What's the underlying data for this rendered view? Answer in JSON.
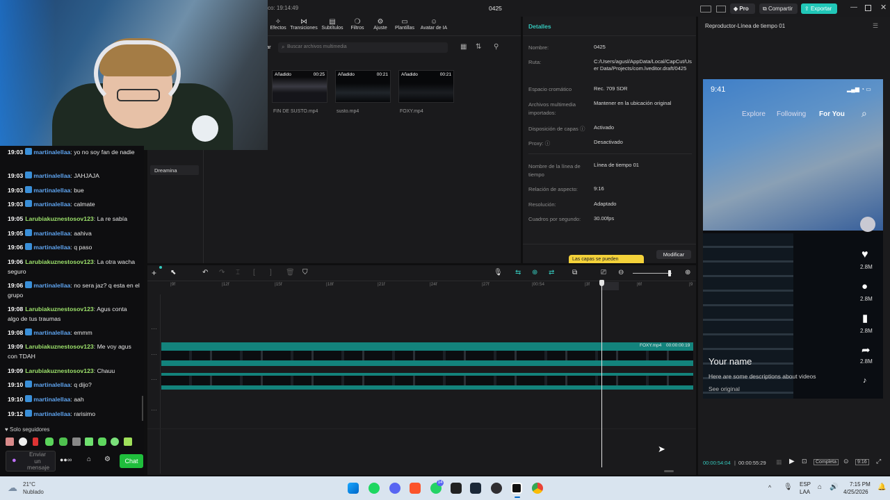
{
  "titlebar": {
    "time_text": "co: 19:14:49",
    "project_name": "0425",
    "pro_label": "Pro",
    "share_label": "Compartir",
    "export_label": "Exportar"
  },
  "toolbar": {
    "tabs": [
      "Efectos",
      "Transiciones",
      "Subtítulos",
      "Filtros",
      "Ajuste",
      "Plantillas",
      "Avatar de IA"
    ]
  },
  "media": {
    "search_placeholder": "Buscar archivos multimedia",
    "side_button": "ar",
    "sidebar_item": "Dreamina",
    "clips": [
      {
        "tag": "Añadido",
        "duration": "00:25",
        "name": "FIN DE SUSTO.mp4"
      },
      {
        "tag": "Añadido",
        "duration": "00:21",
        "name": "susto.mp4"
      },
      {
        "tag": "Añadido",
        "duration": "00:21",
        "name": "FOXY.mp4"
      }
    ]
  },
  "details": {
    "title": "Detalles",
    "rows": [
      {
        "label": "Nombre:",
        "value": "0425"
      },
      {
        "label": "Ruta:",
        "value": "C:/Users/agusl/AppData/Local/CapCut/User Data/Projects/com.lveditor.draft/0425"
      },
      {
        "label": "Espacio cromático",
        "value": "Rec. 709 SDR"
      },
      {
        "label": "Archivos multimedia importados:",
        "value": "Mantener en la ubicación original"
      },
      {
        "label": "Disposición de capas",
        "value": "Activado"
      },
      {
        "label": "Proxy:",
        "value": "Desactivado"
      },
      {
        "label": "Nombre de la línea de tiempo",
        "value": "Línea de tiempo 01"
      },
      {
        "label": "Relación de aspecto:",
        "value": "9:16"
      },
      {
        "label": "Resolución:",
        "value": "Adaptado"
      },
      {
        "label": "Cuadros por segundo:",
        "value": "30.00fps"
      }
    ],
    "tooltip": "Las capas se pueden",
    "modify_button": "Modificar"
  },
  "player": {
    "title": "Reproductor-Línea de tiempo 01",
    "phone": {
      "clock": "9:41",
      "nav": [
        "Explore",
        "Following",
        "For You"
      ],
      "counts": [
        "2.8M",
        "2.8M",
        "2.8M",
        "2.8M"
      ],
      "name": "Your name",
      "desc": "Here are some descriptions about videos",
      "see_original": "See original"
    },
    "current_time": "00:00:54:04",
    "total_time": "00:00:55:29",
    "fit_label": "Completa",
    "ratio_label": "9:16"
  },
  "timeline": {
    "ruler": [
      "|9f",
      "|12f",
      "|15f",
      "|18f",
      "|21f",
      "|24f",
      "|27f",
      "|00:54",
      "|3f",
      "|6f",
      "|9"
    ],
    "clip_label": "FOXY.mp4",
    "clip_time": "00:00:00:19"
  },
  "chat": {
    "messages": [
      {
        "time": "19:03",
        "user": "martinalellaa",
        "text": "yo no soy fan de nadie",
        "type": "u1"
      },
      {
        "time": "19:03",
        "user": "martinalellaa",
        "text": "JAHJAJA",
        "type": "u1"
      },
      {
        "time": "19:03",
        "user": "martinalellaa",
        "text": "bue",
        "type": "u1"
      },
      {
        "time": "19:03",
        "user": "martinalellaa",
        "text": "calmate",
        "type": "u1"
      },
      {
        "time": "19:05",
        "user": "Larubiakuznestosov123",
        "text": "La re sabía",
        "type": "u2"
      },
      {
        "time": "19:05",
        "user": "martinalellaa",
        "text": "aahiva",
        "type": "u1"
      },
      {
        "time": "19:06",
        "user": "martinalellaa",
        "text": "q paso",
        "type": "u1"
      },
      {
        "time": "19:06",
        "user": "Larubiakuznestosov123",
        "text": "La otra wacha seguro",
        "type": "u2"
      },
      {
        "time": "19:06",
        "user": "martinalellaa",
        "text": "no sera jaz? q esta en el grupo",
        "type": "u1"
      },
      {
        "time": "19:08",
        "user": "Larubiakuznestosov123",
        "text": "Agus conta algo de tus traumas",
        "type": "u2"
      },
      {
        "time": "19:08",
        "user": "martinalellaa",
        "text": "emmm",
        "type": "u1"
      },
      {
        "time": "19:09",
        "user": "Larubiakuznestosov123",
        "text": "Me voy agus con TDAH",
        "type": "u2"
      },
      {
        "time": "19:09",
        "user": "Larubiakuznestosov123",
        "text": "Chauu",
        "type": "u2"
      },
      {
        "time": "19:10",
        "user": "martinalellaa",
        "text": "q dijo?",
        "type": "u1"
      },
      {
        "time": "19:10",
        "user": "martinalellaa",
        "text": "aah",
        "type": "u1"
      },
      {
        "time": "19:12",
        "user": "martinalellaa",
        "text": "rarisimo",
        "type": "u1"
      }
    ],
    "followers_only": "Solo seguidores",
    "send_placeholder": "Enviar un mensaje",
    "chat_button": "Chat"
  },
  "taskbar": {
    "weather_temp": "21°C",
    "weather_desc": "Nublado",
    "lang_top": "ESP",
    "lang_bottom": "LAA",
    "clock_time": "7:15 PM",
    "clock_date": "4/25/2026",
    "discord_badge": "14"
  }
}
